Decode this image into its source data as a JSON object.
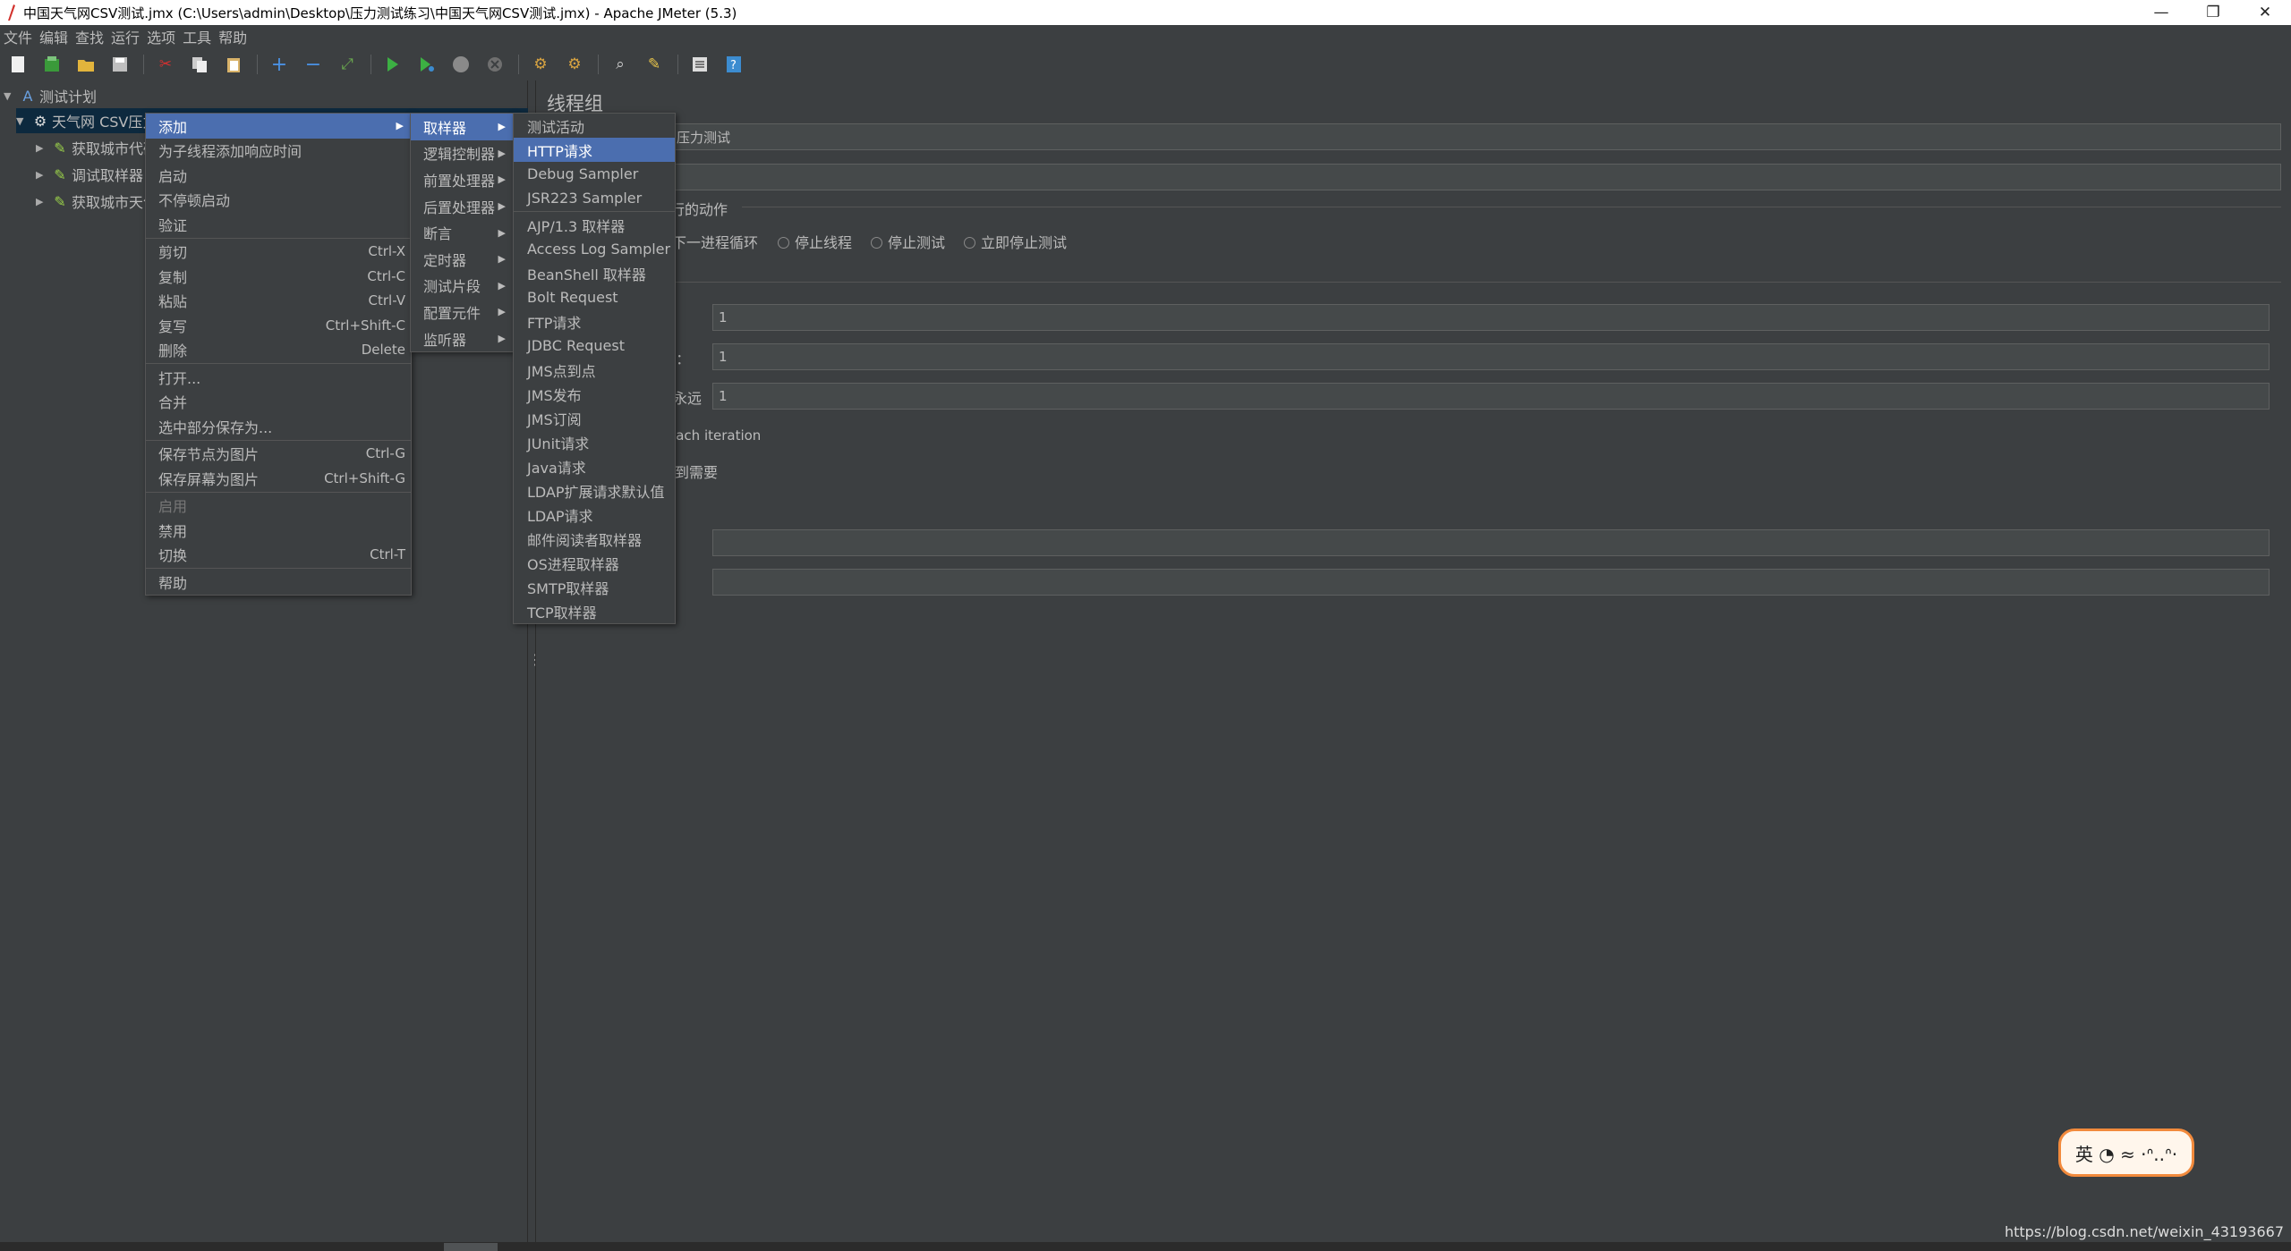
{
  "window": {
    "title": "中国天气网CSV测试.jmx (C:\\Users\\admin\\Desktop\\压力测试练习\\中国天气网CSV测试.jmx) - Apache JMeter (5.3)",
    "minimize": "—",
    "restore": "❐",
    "close": "✕"
  },
  "menubar": [
    "文件",
    "编辑",
    "查找",
    "运行",
    "选项",
    "工具",
    "帮助"
  ],
  "tree": {
    "root": "测试计划",
    "thread_group": "天气网 CSV压力测试",
    "children": [
      "获取城市代码",
      "调试取样器",
      "获取城市天气"
    ]
  },
  "context_menu": {
    "items": [
      {
        "label": "添加",
        "shortcut": "",
        "submenu": true,
        "highlighted": true
      },
      {
        "label": "为子线程添加响应时间",
        "shortcut": ""
      },
      {
        "label": "启动",
        "shortcut": ""
      },
      {
        "label": "不停顿启动",
        "shortcut": ""
      },
      {
        "label": "验证",
        "shortcut": ""
      },
      {
        "sep": true
      },
      {
        "label": "剪切",
        "shortcut": "Ctrl-X"
      },
      {
        "label": "复制",
        "shortcut": "Ctrl-C"
      },
      {
        "label": "粘贴",
        "shortcut": "Ctrl-V"
      },
      {
        "label": "复写",
        "shortcut": "Ctrl+Shift-C"
      },
      {
        "label": "删除",
        "shortcut": "Delete"
      },
      {
        "sep": true
      },
      {
        "label": "打开...",
        "shortcut": ""
      },
      {
        "label": "合并",
        "shortcut": ""
      },
      {
        "label": "选中部分保存为...",
        "shortcut": ""
      },
      {
        "sep": true
      },
      {
        "label": "保存节点为图片",
        "shortcut": "Ctrl-G"
      },
      {
        "label": "保存屏幕为图片",
        "shortcut": "Ctrl+Shift-G"
      },
      {
        "sep": true
      },
      {
        "label": "启用",
        "shortcut": "",
        "disabled": true
      },
      {
        "label": "禁用",
        "shortcut": ""
      },
      {
        "label": "切换",
        "shortcut": "Ctrl-T"
      },
      {
        "sep": true
      },
      {
        "label": "帮助",
        "shortcut": ""
      }
    ]
  },
  "add_submenu": {
    "items": [
      {
        "label": "取样器",
        "highlighted": true
      },
      {
        "label": "逻辑控制器"
      },
      {
        "label": "前置处理器"
      },
      {
        "label": "后置处理器"
      },
      {
        "label": "断言"
      },
      {
        "label": "定时器"
      },
      {
        "label": "测试片段"
      },
      {
        "label": "配置元件"
      },
      {
        "label": "监听器"
      }
    ]
  },
  "sampler_submenu": {
    "items": [
      {
        "label": "测试活动"
      },
      {
        "label": "HTTP请求",
        "highlighted": true
      },
      {
        "label": "Debug Sampler"
      },
      {
        "label": "JSR223 Sampler"
      },
      {
        "sep": true
      },
      {
        "label": "AJP/1.3 取样器"
      },
      {
        "label": "Access Log Sampler"
      },
      {
        "label": "BeanShell 取样器"
      },
      {
        "label": "Bolt Request"
      },
      {
        "label": "FTP请求"
      },
      {
        "label": "JDBC Request"
      },
      {
        "label": "JMS点到点"
      },
      {
        "label": "JMS发布"
      },
      {
        "label": "JMS订阅"
      },
      {
        "label": "JUnit请求"
      },
      {
        "label": "Java请求"
      },
      {
        "label": "LDAP扩展请求默认值"
      },
      {
        "label": "LDAP请求"
      },
      {
        "label": "邮件阅读者取样器"
      },
      {
        "label": "OS进程取样器"
      },
      {
        "label": "SMTP取样器"
      },
      {
        "label": "TCP取样器"
      }
    ]
  },
  "panel": {
    "title": "线程组",
    "name_value": "压力测试",
    "comment_value": "",
    "action_label": "行的动作",
    "radio_next_loop": "下一进程循环",
    "radio_stop_thread": "停止线程",
    "radio_stop_test": "停止测试",
    "radio_stop_now": "立即停止测试",
    "threads_value": "1",
    "rampup_suffix": ")：",
    "rampup_value": "1",
    "loop_suffix": "永远",
    "loop_value": "1",
    "same_user_text": "each iteration",
    "delay_text": "到需要"
  },
  "watermark": "https://blog.csdn.net/weixin_43193667",
  "badge_text": "英 ◔ ≈ ·ᐢ..ᐢ·"
}
